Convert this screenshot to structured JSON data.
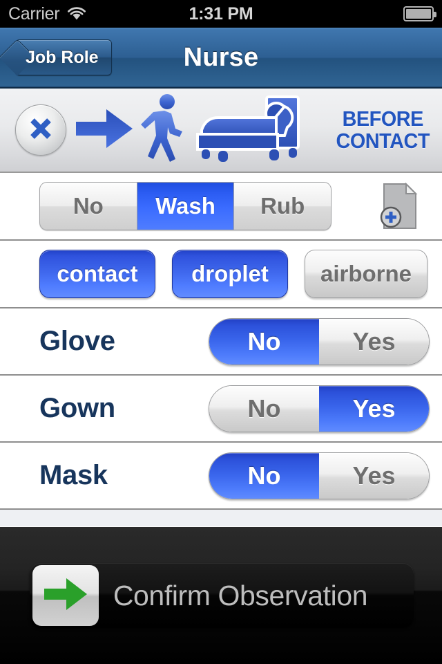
{
  "status_bar": {
    "carrier": "Carrier",
    "wifi_icon": "wifi-icon",
    "time": "1:31 PM",
    "battery_icon": "battery-icon"
  },
  "nav_bar": {
    "back_label": "Job Role",
    "title": "Nurse"
  },
  "banner": {
    "close_icon": "close-x-icon",
    "arrow_icon": "arrow-right-icon",
    "walking_icon": "walking-person-icon",
    "bed_icon": "patient-in-bed-icon",
    "label_line1": "BEFORE",
    "label_line2": "CONTACT",
    "label_color": "#2255c0"
  },
  "hand_hygiene": {
    "options": [
      {
        "label": "No",
        "selected": false
      },
      {
        "label": "Wash",
        "selected": true
      },
      {
        "label": "Rub",
        "selected": false
      }
    ],
    "note_icon": "document-add-icon"
  },
  "precautions": {
    "items": [
      {
        "label": "contact",
        "active": true
      },
      {
        "label": "droplet",
        "active": true
      },
      {
        "label": "airborne",
        "active": false
      }
    ]
  },
  "ppe_rows": [
    {
      "label": "Glove",
      "no_label": "No",
      "yes_label": "Yes",
      "value": "No"
    },
    {
      "label": "Gown",
      "no_label": "No",
      "yes_label": "Yes",
      "value": "Yes"
    },
    {
      "label": "Mask",
      "no_label": "No",
      "yes_label": "Yes",
      "value": "No"
    }
  ],
  "toolbar": {
    "confirm_icon": "green-arrow-right-icon",
    "confirm_label_plain": "C",
    "confirm_label_full": "Confirm Observation",
    "confirm_prefix": "Confirm ",
    "confirm_emphasis": "Ob",
    "confirm_suffix": "servation"
  },
  "theme": {
    "accent_blue": "#3b6cff",
    "nav_blue": "#2d5f92",
    "label_navy": "#17355c",
    "green": "#2aa02a",
    "inactive_gray": "#6e6e6e"
  }
}
